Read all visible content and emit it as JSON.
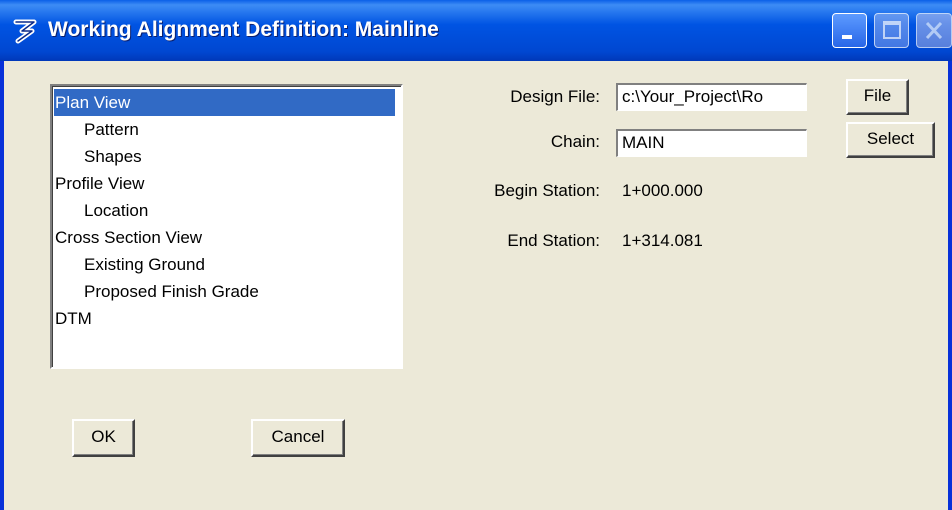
{
  "window": {
    "title": "Working Alignment Definition: Mainline",
    "controls": [
      "minimize-icon",
      "maximize-icon",
      "close-icon"
    ]
  },
  "tree": {
    "items": [
      {
        "label": "Plan View",
        "level": 0,
        "selected": true
      },
      {
        "label": "Pattern",
        "level": 1,
        "selected": false
      },
      {
        "label": "Shapes",
        "level": 1,
        "selected": false
      },
      {
        "label": "Profile View",
        "level": 0,
        "selected": false
      },
      {
        "label": "Location",
        "level": 1,
        "selected": false
      },
      {
        "label": "Cross Section View",
        "level": 0,
        "selected": false
      },
      {
        "label": "Existing Ground",
        "level": 1,
        "selected": false
      },
      {
        "label": "Proposed Finish Grade",
        "level": 1,
        "selected": false
      },
      {
        "label": "DTM",
        "level": 0,
        "selected": false
      }
    ]
  },
  "form": {
    "design_file_label": "Design File:",
    "design_file_value": "c:\\Your_Project\\Ro",
    "chain_label": "Chain:",
    "chain_value": "MAIN",
    "begin_station_label": "Begin Station:",
    "begin_station_value": "1+000.000",
    "end_station_label": "End Station:",
    "end_station_value": "1+314.081"
  },
  "buttons": {
    "file": "File",
    "select": "Select",
    "ok": "OK",
    "cancel": "Cancel"
  },
  "colors": {
    "titlebar": "#0054e3",
    "selection": "#316ac5",
    "dialog_bg": "#ece9d8"
  }
}
